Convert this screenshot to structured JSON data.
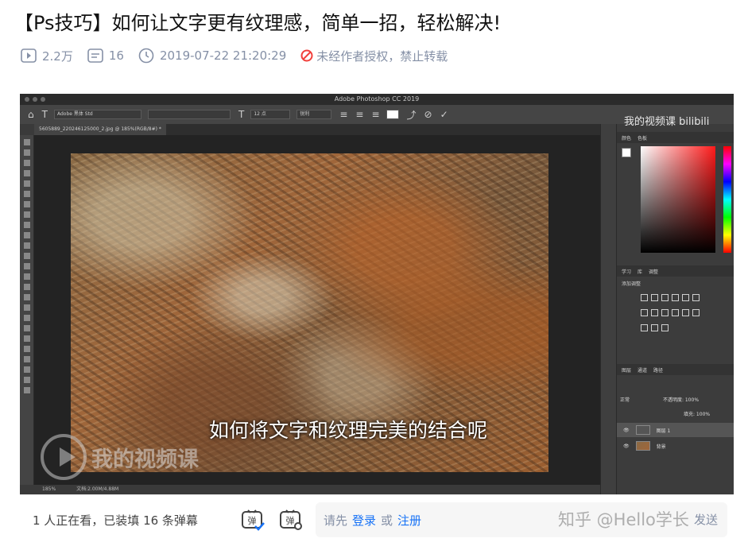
{
  "title": "【Ps技巧】如何让文字更有纹理感，简单一招，轻松解决!",
  "meta": {
    "plays": "2.2万",
    "danmaku_count": "16",
    "datetime": "2019-07-22 21:20:29",
    "copyright_notice": "未经作者授权，禁止转载"
  },
  "video": {
    "ps_app_title": "Adobe Photoshop CC 2019",
    "ps_font": "Adobe 黑体 Std",
    "ps_font_size": "12 点",
    "ps_antialias": "锐利",
    "ps_doc_tab": "5605889_220246125000_2.jpg @ 185%(RGB/8#) *",
    "ps_zoom": "185%",
    "ps_doc_size": "文档:2.00M/4.88M",
    "ps_panel_tabs_color": [
      "颜色",
      "色板"
    ],
    "ps_panel_tabs_adjust": [
      "学习",
      "库",
      "调整"
    ],
    "ps_add_adjustment": "添加调整",
    "ps_panel_tabs_layers": [
      "图层",
      "通道",
      "路径"
    ],
    "ps_blend_mode": "正常",
    "ps_opacity": "不透明度: 100%",
    "ps_fill": "填充: 100%",
    "ps_layers": [
      "图层 1",
      "背景"
    ],
    "brand_watermark": "我的视频课 bilibili",
    "subtitle": "如何将文字和纹理完美的结合呢",
    "channel_watermark": "我的视频课"
  },
  "danmaku_bar": {
    "watching": "1 人正在看，已装填 16 条弹幕",
    "prompt_prefix": "请先",
    "login": "登录",
    "or": "或",
    "register": "注册",
    "send": "发送",
    "site_watermark": "知乎 @Hello学长"
  },
  "colors": {
    "link": "#1772f6",
    "meta_gray": "#8590a6",
    "warn_red": "#f1403c"
  }
}
